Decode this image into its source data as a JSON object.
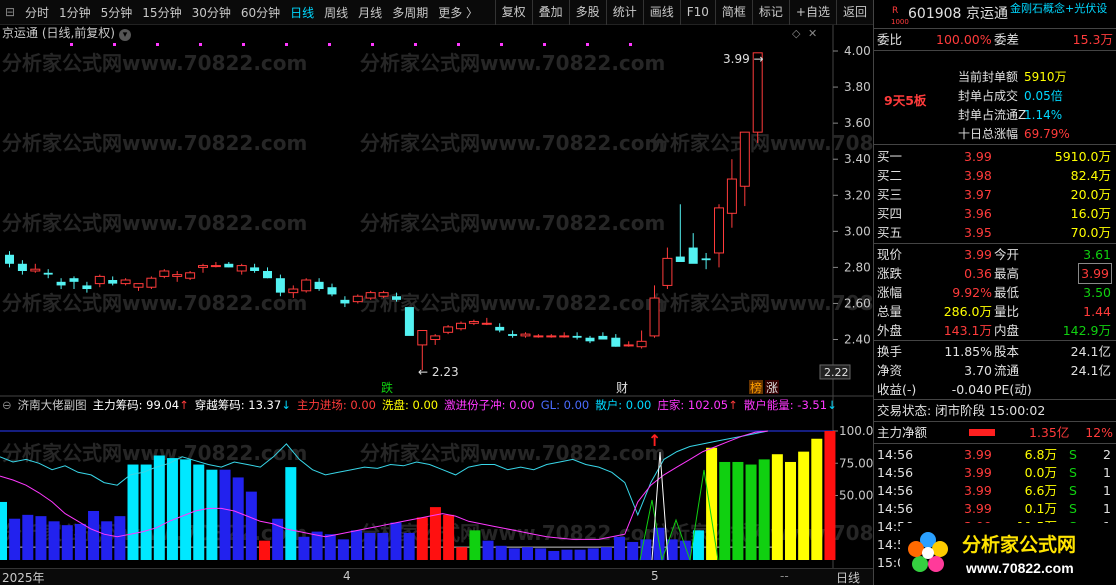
{
  "toolbar": {
    "timeframes": [
      "分时",
      "1分钟",
      "5分钟",
      "15分钟",
      "30分钟",
      "60分钟",
      "日线",
      "周线",
      "月线",
      "多周期",
      "更多 〉"
    ],
    "active_timeframe": "日线",
    "tools": [
      "复权",
      "叠加",
      "多股",
      "统计",
      "画线",
      "F10",
      "简框",
      "标记",
      "+自选",
      "返回"
    ]
  },
  "stock_title": "京运通 (日线,前复权)",
  "stock_title_dropdown_icon": "chevron-down-icon",
  "watermark": "分析家公式网www.70822.com",
  "chart_data": {
    "type": "candlestick",
    "dates_labels": [
      "2025年",
      "4",
      "5"
    ],
    "period_label": "日线",
    "ylim": [
      2.12,
      4.05
    ],
    "yticks": [
      "4.00",
      "3.80",
      "3.60",
      "3.40",
      "3.20",
      "3.00",
      "2.80",
      "2.60",
      "2.40"
    ],
    "current_price_tag": "2.22",
    "ohlc": [
      [
        2.87,
        2.89,
        2.8,
        2.82
      ],
      [
        2.82,
        2.84,
        2.76,
        2.78
      ],
      [
        2.78,
        2.82,
        2.77,
        2.79
      ],
      [
        2.77,
        2.79,
        2.74,
        2.76
      ],
      [
        2.72,
        2.74,
        2.68,
        2.7
      ],
      [
        2.74,
        2.75,
        2.68,
        2.72
      ],
      [
        2.7,
        2.72,
        2.66,
        2.68
      ],
      [
        2.71,
        2.76,
        2.69,
        2.75
      ],
      [
        2.73,
        2.75,
        2.7,
        2.71
      ],
      [
        2.71,
        2.74,
        2.7,
        2.73
      ],
      [
        2.69,
        2.71,
        2.67,
        2.71
      ],
      [
        2.69,
        2.75,
        2.68,
        2.74
      ],
      [
        2.75,
        2.79,
        2.74,
        2.78
      ],
      [
        2.75,
        2.78,
        2.72,
        2.76
      ],
      [
        2.74,
        2.78,
        2.73,
        2.77
      ],
      [
        2.8,
        2.82,
        2.77,
        2.81
      ],
      [
        2.81,
        2.83,
        2.8,
        2.81
      ],
      [
        2.82,
        2.83,
        2.8,
        2.8
      ],
      [
        2.78,
        2.82,
        2.76,
        2.81
      ],
      [
        2.8,
        2.82,
        2.77,
        2.78
      ],
      [
        2.78,
        2.8,
        2.74,
        2.74
      ],
      [
        2.74,
        2.76,
        2.64,
        2.66
      ],
      [
        2.66,
        2.7,
        2.63,
        2.68
      ],
      [
        2.67,
        2.74,
        2.66,
        2.73
      ],
      [
        2.72,
        2.74,
        2.67,
        2.68
      ],
      [
        2.69,
        2.71,
        2.64,
        2.65
      ],
      [
        2.62,
        2.64,
        2.58,
        2.6
      ],
      [
        2.61,
        2.65,
        2.6,
        2.64
      ],
      [
        2.63,
        2.67,
        2.62,
        2.66
      ],
      [
        2.64,
        2.67,
        2.63,
        2.66
      ],
      [
        2.64,
        2.66,
        2.61,
        2.62
      ],
      [
        2.58,
        2.57,
        2.48,
        2.42
      ],
      [
        2.37,
        2.43,
        2.23,
        2.45
      ],
      [
        2.4,
        2.43,
        2.37,
        2.42
      ],
      [
        2.44,
        2.48,
        2.43,
        2.47
      ],
      [
        2.46,
        2.5,
        2.45,
        2.49
      ],
      [
        2.49,
        2.51,
        2.48,
        2.5
      ],
      [
        2.49,
        2.52,
        2.48,
        2.49
      ],
      [
        2.47,
        2.49,
        2.44,
        2.45
      ],
      [
        2.43,
        2.45,
        2.41,
        2.42
      ],
      [
        2.42,
        2.44,
        2.41,
        2.43
      ],
      [
        2.42,
        2.43,
        2.41,
        2.42
      ],
      [
        2.42,
        2.43,
        2.41,
        2.42
      ],
      [
        2.42,
        2.44,
        2.41,
        2.42
      ],
      [
        2.42,
        2.44,
        2.4,
        2.41
      ],
      [
        2.41,
        2.42,
        2.38,
        2.39
      ],
      [
        2.42,
        2.44,
        2.4,
        2.4
      ],
      [
        2.41,
        2.43,
        2.36,
        2.36
      ],
      [
        2.37,
        2.39,
        2.36,
        2.37
      ],
      [
        2.36,
        2.45,
        2.35,
        2.39
      ],
      [
        2.42,
        2.7,
        2.41,
        2.63
      ],
      [
        2.7,
        2.91,
        2.68,
        2.85
      ],
      [
        2.86,
        3.15,
        2.84,
        2.83
      ],
      [
        2.91,
        2.99,
        2.85,
        2.82
      ],
      [
        2.85,
        2.88,
        2.79,
        2.84
      ],
      [
        2.88,
        3.15,
        2.8,
        3.13
      ],
      [
        3.1,
        3.4,
        3.02,
        3.29
      ],
      [
        3.25,
        3.54,
        3.14,
        3.55
      ],
      [
        3.55,
        3.99,
        3.49,
        3.99
      ]
    ],
    "annotations": {
      "high": "3.99",
      "low": "2.23",
      "marks": [
        "跌",
        "财",
        "榜",
        "涨"
      ]
    }
  },
  "indicator": {
    "title": "济南大佬副图",
    "items": [
      {
        "label": "主力筹码: 99.04",
        "color": "#ffffff"
      },
      {
        "label": "↑",
        "color": "#ff3b3b"
      },
      {
        "label": "穿越筹码: 13.37",
        "color": "#ffffff"
      },
      {
        "label": "↓",
        "color": "#00d8ff"
      },
      {
        "label": "主力进场: 0.00",
        "color": "#ff3b3b"
      },
      {
        "label": "洗盘: 0.00",
        "color": "#ffff00"
      },
      {
        "label": "激进份子冲: 0.00",
        "color": "#ff38ff"
      },
      {
        "label": "GL: 0.00",
        "color": "#4a6cff"
      },
      {
        "label": "散户: 0.00",
        "color": "#00d8ff"
      },
      {
        "label": "庄家: 102.05",
        "color": "#ff38ff"
      },
      {
        "label": "↑",
        "color": "#ff3b3b"
      },
      {
        "label": "散户能量: -3.51",
        "color": "#ff38ff"
      },
      {
        "label": "↓",
        "color": "#00d8ff"
      }
    ],
    "yticks": [
      "100.0",
      "75.00",
      "50.00"
    ],
    "bars": [
      45,
      32,
      35,
      34,
      30,
      27,
      28,
      38,
      30,
      34,
      74,
      74,
      81,
      79,
      78,
      74,
      70,
      70,
      64,
      53,
      15,
      32,
      72,
      18,
      22,
      20,
      16,
      23,
      21,
      21,
      29,
      21,
      33,
      41,
      35,
      10,
      23,
      15,
      11,
      9,
      10,
      9,
      7,
      8,
      8,
      9,
      10,
      18,
      14,
      16,
      25,
      16,
      15,
      23,
      87,
      76,
      76,
      74,
      78,
      82,
      76,
      84,
      94,
      100
    ],
    "bar_colors": [
      "cyan",
      "blue",
      "blue",
      "blue",
      "blue",
      "blue",
      "blue",
      "blue",
      "blue",
      "blue",
      "cyan",
      "cyan",
      "cyan",
      "cyan",
      "cyan",
      "cyan",
      "cyan",
      "blue",
      "blue",
      "blue",
      "red",
      "blue",
      "cyan",
      "blue",
      "blue",
      "blue",
      "blue",
      "blue",
      "blue",
      "blue",
      "blue",
      "blue",
      "red",
      "red",
      "red",
      "red",
      "green",
      "blue",
      "blue",
      "blue",
      "blue",
      "blue",
      "blue",
      "blue",
      "blue",
      "blue",
      "blue",
      "blue",
      "blue",
      "blue",
      "blue",
      "blue",
      "blue",
      "cyan",
      "yellow",
      "green",
      "green",
      "green",
      "green",
      "yellow",
      "yellow",
      "yellow",
      "yellow",
      "red"
    ]
  },
  "quote": {
    "code_prefix": "R",
    "code_sub": "1000",
    "code": "601908",
    "name": "京运通",
    "concept": "金刚石概念+光伏设",
    "weibi_label": "委比",
    "weibi": "100.00%",
    "weicha_label": "委差",
    "weicha": "15.3万",
    "limit_badge": "9天5板",
    "seal_rows": [
      {
        "label": "当前封单额",
        "value": "5910万",
        "vcolor": "yellow"
      },
      {
        "label": "封单占成交",
        "value": "0.05倍",
        "vcolor": "cyan"
      },
      {
        "label": "封单占流通Z",
        "value": "1.14%",
        "vcolor": "cyan"
      },
      {
        "label": "十日总涨幅",
        "value": "69.79%",
        "vcolor": "red"
      }
    ],
    "bids": [
      {
        "label": "买一",
        "price": "3.99",
        "vol": "5910.0万"
      },
      {
        "label": "买二",
        "price": "3.98",
        "vol": "82.4万"
      },
      {
        "label": "买三",
        "price": "3.97",
        "vol": "20.0万"
      },
      {
        "label": "买四",
        "price": "3.96",
        "vol": "16.0万"
      },
      {
        "label": "买五",
        "price": "3.95",
        "vol": "70.0万"
      }
    ],
    "stats": [
      {
        "l1": "现价",
        "v1": "3.99",
        "c1": "red",
        "l2": "今开",
        "v2": "3.61",
        "c2": "green"
      },
      {
        "l1": "涨跌",
        "v1": "0.36",
        "c1": "red",
        "l2": "最高",
        "v2": "3.99",
        "c2": "red"
      },
      {
        "l1": "涨幅",
        "v1": "9.92%",
        "c1": "red",
        "l2": "最低",
        "v2": "3.50",
        "c2": "green"
      },
      {
        "l1": "总量",
        "v1": "286.0万",
        "c1": "yellow",
        "l2": "量比",
        "v2": "1.44",
        "c2": "red"
      },
      {
        "l1": "外盘",
        "v1": "143.1万",
        "c1": "red",
        "l2": "内盘",
        "v2": "142.9万",
        "c2": "green"
      }
    ],
    "stats2": [
      {
        "l1": "换手",
        "v1": "11.85%",
        "l2": "股本",
        "v2": "24.1亿"
      },
      {
        "l1": "净资",
        "v1": "3.70",
        "l2": "流通",
        "v2": "24.1亿"
      },
      {
        "l1": "收益(-)",
        "v1": "-0.040",
        "l2": "PE(动)",
        "v2": ""
      }
    ],
    "trade_status": "交易状态: 闭市阶段 15:00:02",
    "main_net_label": "主力净额",
    "main_net_value": "1.35亿",
    "main_net_pct": "12%",
    "ticks": [
      {
        "t": "14:56",
        "p": "3.99",
        "v": "6.8万",
        "s": "S",
        "n": "2"
      },
      {
        "t": "14:56",
        "p": "3.99",
        "v": "0.0万",
        "s": "S",
        "n": "1"
      },
      {
        "t": "14:56",
        "p": "3.99",
        "v": "6.6万",
        "s": "S",
        "n": "1"
      },
      {
        "t": "14:56",
        "p": "3.99",
        "v": "0.1万",
        "s": "S",
        "n": "1"
      },
      {
        "t": "14:56",
        "p": "3.99",
        "v": "11.5万",
        "s": "S",
        "n": "1"
      },
      {
        "t": "14:56",
        "p": "",
        "v": "",
        "s": "",
        "n": ""
      },
      {
        "t": "15:00",
        "p": "",
        "v": "",
        "s": "",
        "n": ""
      }
    ]
  },
  "logo": {
    "title": "分析家公式网",
    "url": "www.70822.com"
  }
}
